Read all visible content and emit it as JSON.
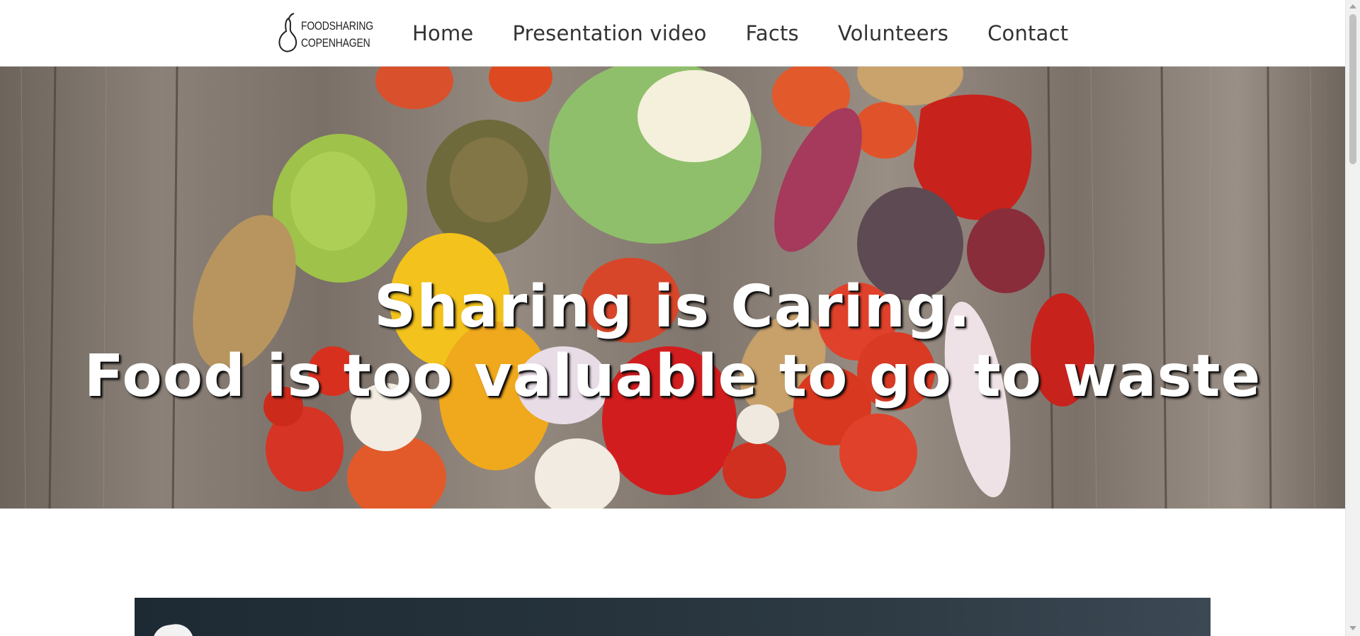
{
  "brand": {
    "logo_line1": "FOODSHARING",
    "logo_line2": "COPENHAGEN",
    "logo_icon": "pear-icon"
  },
  "nav": {
    "items": [
      {
        "label": "Home"
      },
      {
        "label": "Presentation video"
      },
      {
        "label": "Facts"
      },
      {
        "label": "Volunteers"
      },
      {
        "label": "Contact"
      }
    ]
  },
  "hero": {
    "line1": "Sharing is Caring.",
    "line2": "Food is too valuable to go to waste",
    "background": "vegetables-on-wooden-table-image"
  },
  "colors": {
    "nav_text": "#333333",
    "hero_text": "#ffffff",
    "dark_section": "#25323c"
  }
}
